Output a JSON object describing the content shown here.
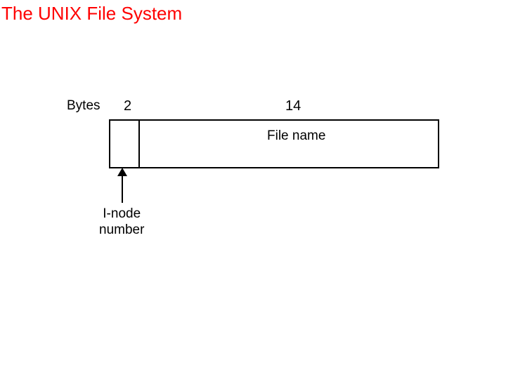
{
  "title": "The UNIX File System",
  "diagram": {
    "bytes_label": "Bytes",
    "col1_width": "2",
    "col2_width": "14",
    "filename_label": "File name",
    "inode_label_line1": "I-node",
    "inode_label_line2": "number"
  }
}
